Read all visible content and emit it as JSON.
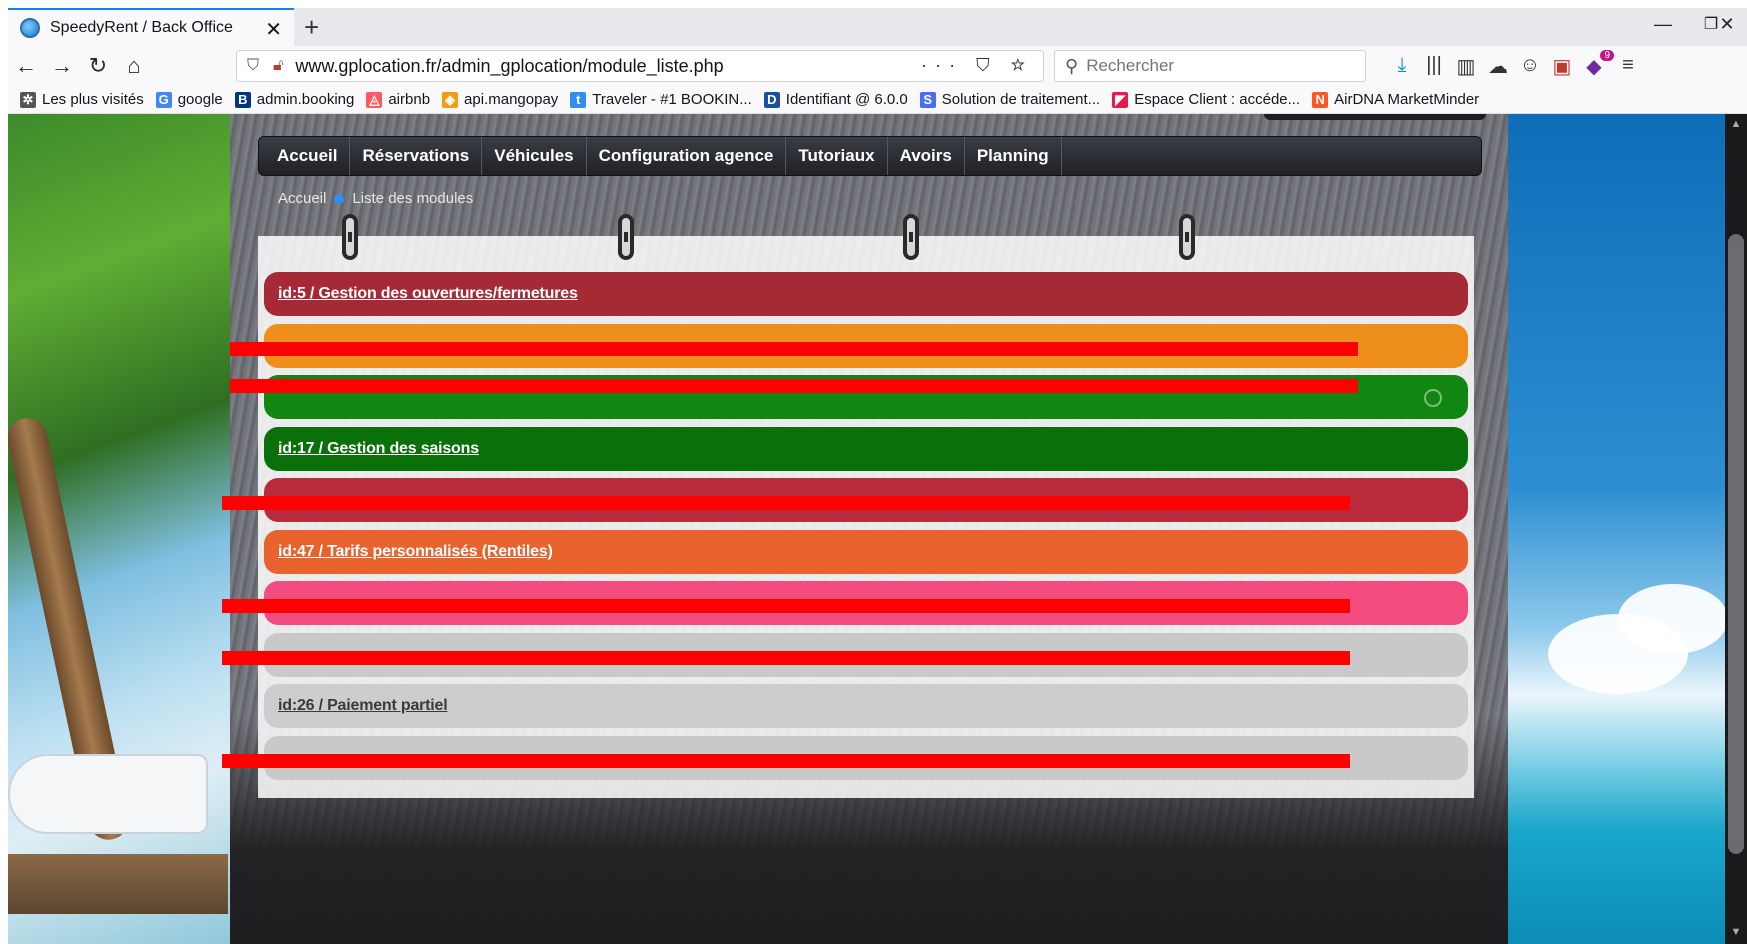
{
  "browser": {
    "tab_title": "SpeedyRent / Back Office",
    "url": "www.gplocation.fr/admin_gplocation/module_liste.php",
    "url_actions": "··· ⛉ ☆",
    "search_placeholder": "Rechercher",
    "notification_count": "9",
    "bookmarks": [
      {
        "label": "Les plus visités",
        "icon": "gear-icon",
        "color": "#555555"
      },
      {
        "label": "google",
        "icon": "google-icon",
        "color": "#4285f4"
      },
      {
        "label": "admin.booking",
        "icon": "booking-icon",
        "color": "#003580"
      },
      {
        "label": "airbnb",
        "icon": "airbnb-icon",
        "color": "#ff5a5f"
      },
      {
        "label": "api.mangopay",
        "icon": "mangopay-icon",
        "color": "#f39c12"
      },
      {
        "label": "Traveler - #1 BOOKIN...",
        "icon": "traveler-icon",
        "color": "#2e8ff0"
      },
      {
        "label": "Identifiant @ 6.0.0",
        "icon": "d-icon",
        "color": "#1a4fa0"
      },
      {
        "label": "Solution de traitement...",
        "icon": "s-icon",
        "color": "#4a6cf7"
      },
      {
        "label": "Espace Client : accéde...",
        "icon": "espace-icon",
        "color": "#e6194b"
      },
      {
        "label": "AirDNA MarketMinder",
        "icon": "airdna-icon",
        "color": "#ff5722"
      }
    ]
  },
  "menu": {
    "items": [
      "Accueil",
      "Réservations",
      "Véhicules",
      "Configuration agence",
      "Tutoriaux",
      "Avoirs",
      "Planning"
    ]
  },
  "breadcrumb": {
    "home": "Accueil",
    "current": "Liste des modules"
  },
  "modules": [
    {
      "label": "id:5 / Gestion des ouvertures/fermetures",
      "color": "#a52a36",
      "redacted": false
    },
    {
      "label": "",
      "color": "#ee8e1b",
      "redacted": true
    },
    {
      "label": "",
      "color": "#118611",
      "redacted": true
    },
    {
      "label": "id:17 / Gestion des saisons",
      "color": "#0a700a",
      "redacted": false
    },
    {
      "label": "",
      "color": "#b72b3d",
      "redacted": true
    },
    {
      "label": "id:47 / Tarifs personnalisés (Rentiles)",
      "color": "#e8632e",
      "redacted": false
    },
    {
      "label": "",
      "color": "#f24c80",
      "redacted": true
    },
    {
      "label": "",
      "color": "#c9c9c9",
      "redacted": true
    },
    {
      "label": "id:26 / Paiement partiel",
      "color": "#cdcdcd",
      "redacted": false
    },
    {
      "label": "",
      "color": "#c9c9c9",
      "redacted": true
    }
  ]
}
